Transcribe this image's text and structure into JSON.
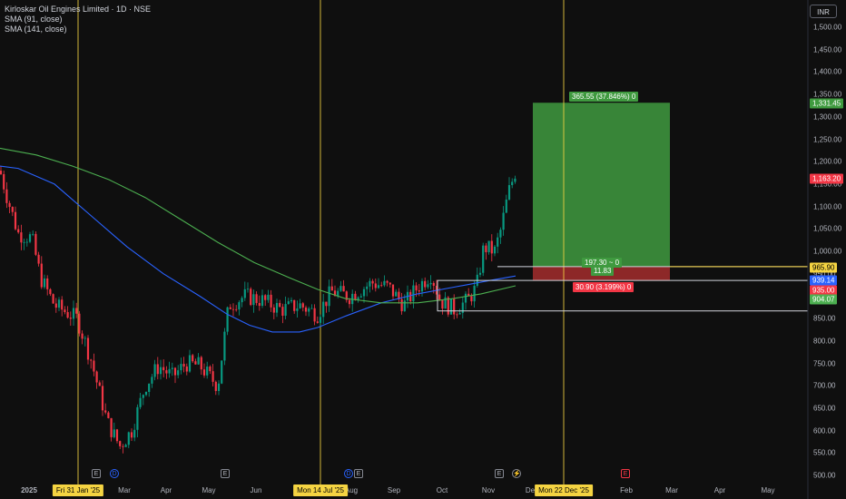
{
  "legend": {
    "title": "Kirloskar Oil Engines Limited · 1D · NSE",
    "sma1": "SMA (91, close)",
    "sma2": "SMA (141, close)"
  },
  "currency_button": "INR",
  "y_axis": [
    "1,500.00",
    "1,450.00",
    "1,400.00",
    "1,350.00",
    "1,300.00",
    "1,250.00",
    "1,200.00",
    "1,150.00",
    "1,100.00",
    "1,050.00",
    "1,000.00",
    "950.00",
    "900.00",
    "850.00",
    "800.00",
    "750.00",
    "700.00",
    "650.00",
    "600.00",
    "550.00",
    "500.00"
  ],
  "x_axis": [
    "2025",
    "Mar",
    "Apr",
    "May",
    "Jun",
    "Aug",
    "Sep",
    "Oct",
    "Nov",
    "Dec",
    "Feb",
    "Mar",
    "Apr",
    "May"
  ],
  "vertical_markers": [
    "Fri 31 Jan '25",
    "Mon 14 Jul '25",
    "Mon 22 Dec '25"
  ],
  "price_tags": {
    "tp": "1,331.45",
    "last": "1,163.20",
    "entry": "965.90",
    "sma_blue": "939.14",
    "stop": "935.00",
    "sma_green": "904.07"
  },
  "position_tool": {
    "target_label": "365.55 (37.846%) 0",
    "center_label_1": "197.30 ~ 0",
    "center_label_2": "11.83",
    "stop_label": "30.90 (3.199%) 0"
  },
  "events": [
    "E",
    "D",
    "E",
    "D",
    "E",
    "E",
    "E"
  ],
  "colors": {
    "background": "#0f0f0f",
    "up": "#089981",
    "down": "#f23645",
    "sma91": "#2962ff",
    "sma141": "#4caf50",
    "marker": "#f5d442",
    "target_zone": "#3f9a3f",
    "stop_zone": "#a32d2d"
  },
  "chart_data": {
    "type": "candlestick",
    "title": "Kirloskar Oil Engines Limited · 1D · NSE",
    "series": [
      {
        "name": "SMA (91, close)"
      },
      {
        "name": "SMA (141, close)"
      }
    ],
    "ylim": [
      500,
      1500
    ],
    "price_points": [
      {
        "x": "Dec '24",
        "y": 1180
      },
      {
        "x": "Jan '25",
        "y": 1030
      },
      {
        "x": "Feb '25",
        "y": 880
      },
      {
        "x": "Mar '25",
        "y": 560
      },
      {
        "x": "Apr '25",
        "y": 720
      },
      {
        "x": "May '25",
        "y": 740
      },
      {
        "x": "Jun '25",
        "y": 890
      },
      {
        "x": "Jul '25",
        "y": 910
      },
      {
        "x": "Aug '25",
        "y": 920
      },
      {
        "x": "Sep '25",
        "y": 930
      },
      {
        "x": "Oct '25",
        "y": 880
      },
      {
        "x": "Nov '25",
        "y": 1163.2
      }
    ],
    "position": {
      "entry": 965.9,
      "target": 1331.45,
      "stop": 935.0
    }
  }
}
